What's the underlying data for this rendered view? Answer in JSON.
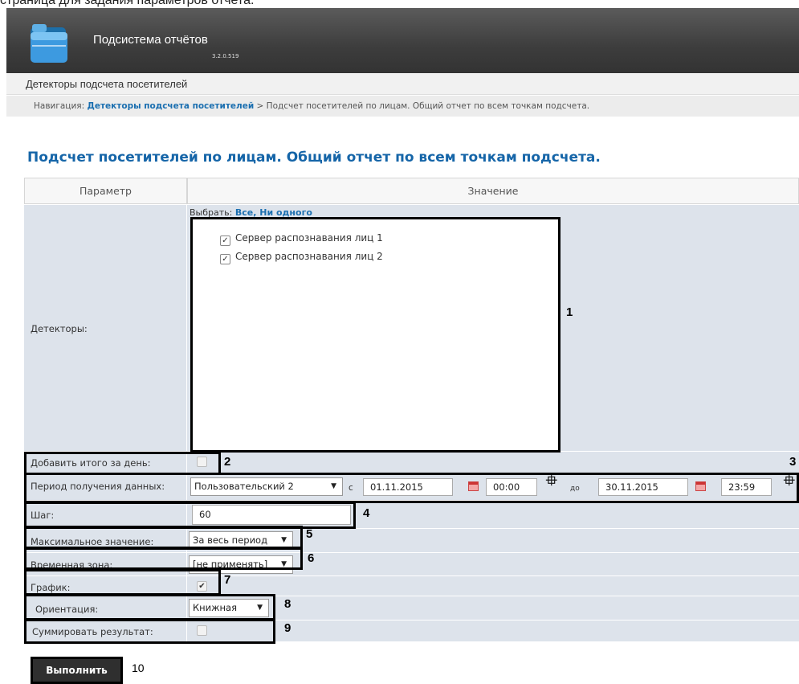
{
  "caption": "страница для задания параметров отчета.",
  "app": {
    "title": "Подсистема отчётов",
    "version": "3.2.0.519"
  },
  "section": "Детекторы подсчета посетителей",
  "nav": {
    "prefix": "Навигация: ",
    "link": "Детекторы подсчета посетителей",
    "rest": " > Подсчет посетителей по лицам. Общий отчет по всем точкам подсчета."
  },
  "page_title": "Подсчет посетителей по лицам. Общий отчет по всем точкам подсчета.",
  "table": {
    "col_param": "Параметр",
    "col_value": "Значение"
  },
  "detectors": {
    "label": "Детекторы:",
    "select_prefix": "Выбрать: ",
    "select_all": "Все",
    "select_none": "Ни одного",
    "items": [
      {
        "label": "Сервер распознавания лиц 1",
        "checked": true
      },
      {
        "label": "Сервер распознавания лиц 2",
        "checked": true
      }
    ]
  },
  "add_total": {
    "label": "Добавить итого за день:",
    "checked": false
  },
  "period": {
    "label": "Период получения данных:",
    "preset": "Пользовательский 2",
    "from_label": "с",
    "from_date": "01.11.2015",
    "from_time": "00:00",
    "to_label": "до",
    "to_date": "30.11.2015",
    "to_time": "23:59"
  },
  "step": {
    "label": "Шаг:",
    "value": "60"
  },
  "max_value": {
    "label": "Максимальное значение:",
    "value": "За весь период"
  },
  "timezone": {
    "label": "Временная зона:",
    "value": "[не применять]"
  },
  "graph": {
    "label": "График:",
    "checked": true
  },
  "orientation": {
    "label": "Ориентация:",
    "value": "Книжная"
  },
  "sum_result": {
    "label": "Суммировать результат:",
    "checked": false
  },
  "run_button": "Выполнить",
  "callouts": [
    "1",
    "2",
    "3",
    "4",
    "5",
    "6",
    "7",
    "8",
    "9",
    "10"
  ]
}
